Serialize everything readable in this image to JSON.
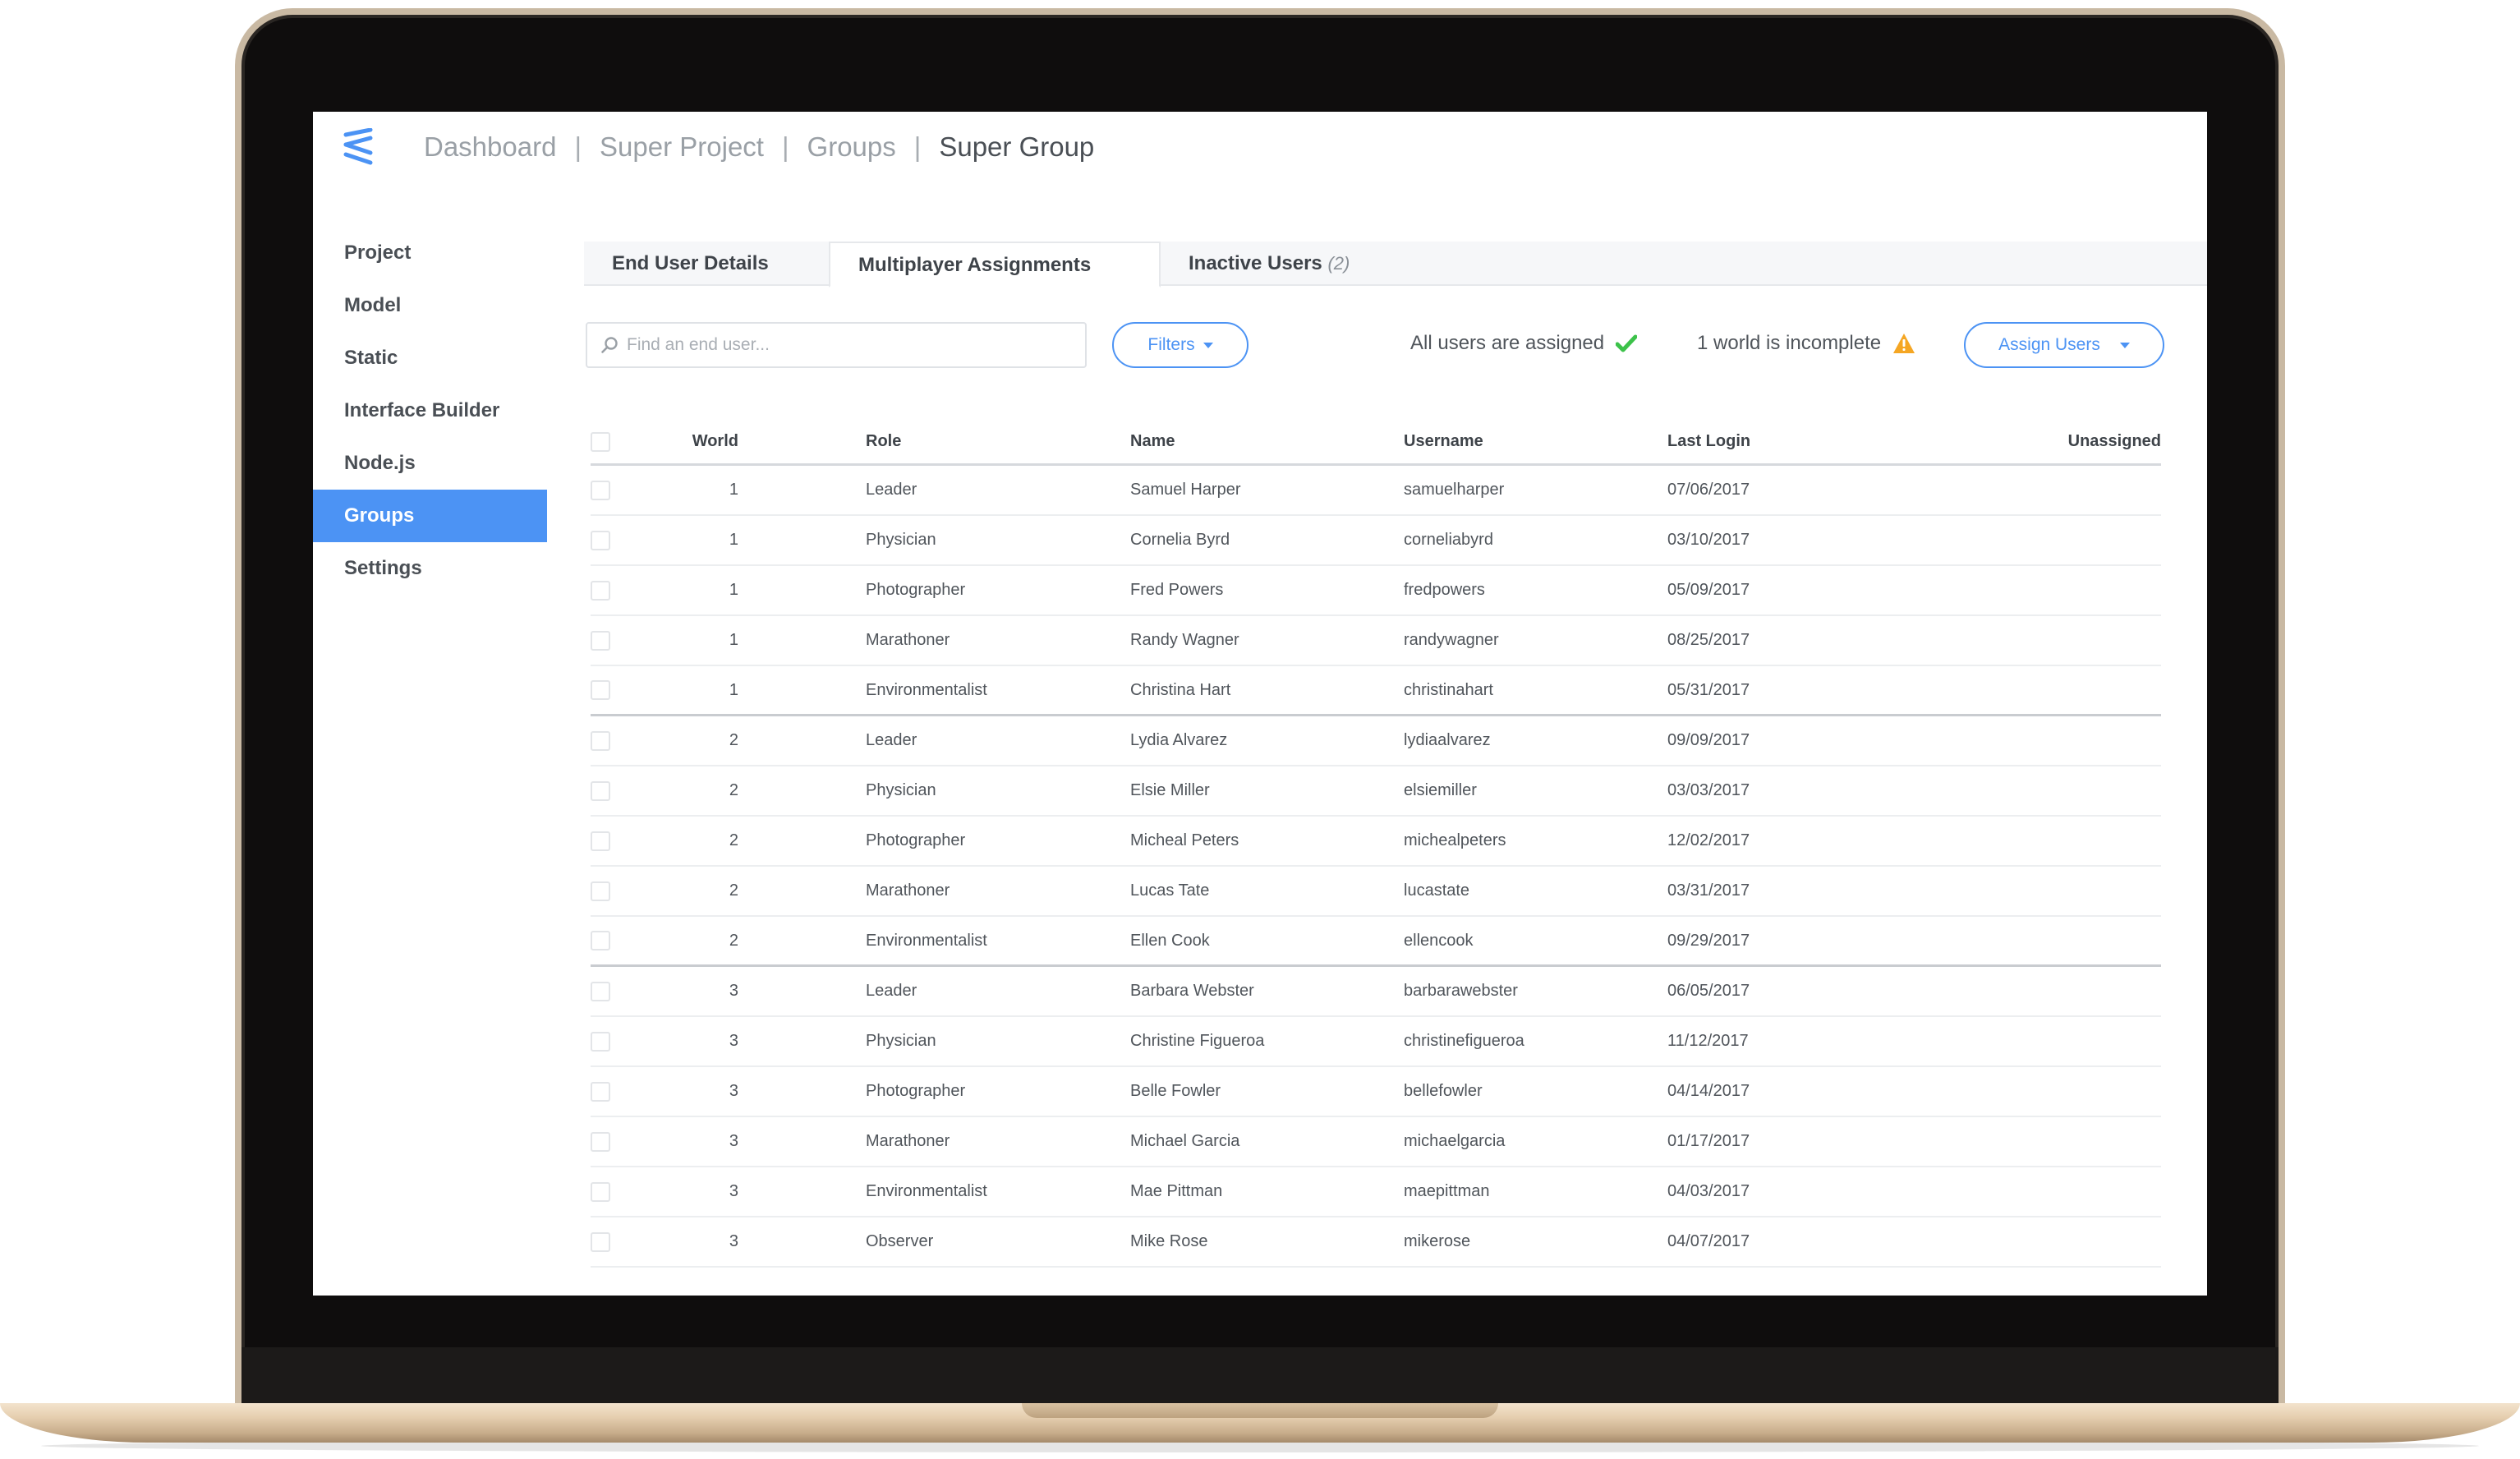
{
  "breadcrumb": [
    "Dashboard",
    "Super Project",
    "Groups",
    "Super Group"
  ],
  "breadcrumb_separator": "|",
  "sidebar": {
    "items": [
      {
        "label": "Project"
      },
      {
        "label": "Model"
      },
      {
        "label": "Static"
      },
      {
        "label": "Interface Builder"
      },
      {
        "label": "Node.js"
      },
      {
        "label": "Groups",
        "active": true
      },
      {
        "label": "Settings"
      }
    ]
  },
  "tabs": [
    {
      "label": "End User Details"
    },
    {
      "label": "Multiplayer Assignments",
      "active": true
    },
    {
      "label": "Inactive Users",
      "count": "(2)"
    }
  ],
  "toolbar": {
    "search_placeholder": "Find an end user...",
    "filters_label": "Filters",
    "status_assigned": "All users are assigned",
    "status_incomplete": "1 world is incomplete",
    "assign_users_label": "Assign Users"
  },
  "colors": {
    "accent": "#4c93f4",
    "success": "#3cc24a",
    "warning": "#f5a623"
  },
  "table": {
    "columns": [
      "World",
      "Role",
      "Name",
      "Username",
      "Last Login",
      "Unassigned"
    ],
    "rows": [
      {
        "world": "1",
        "role": "Leader",
        "name": "Samuel Harper",
        "username": "samuelharper",
        "last_login": "07/06/2017"
      },
      {
        "world": "1",
        "role": "Physician",
        "name": "Cornelia Byrd",
        "username": "corneliabyrd",
        "last_login": "03/10/2017"
      },
      {
        "world": "1",
        "role": "Photographer",
        "name": "Fred Powers",
        "username": "fredpowers",
        "last_login": "05/09/2017"
      },
      {
        "world": "1",
        "role": "Marathoner",
        "name": "Randy Wagner",
        "username": "randywagner",
        "last_login": "08/25/2017"
      },
      {
        "world": "1",
        "role": "Environmentalist",
        "name": "Christina Hart",
        "username": "christinahart",
        "last_login": "05/31/2017"
      },
      {
        "world": "2",
        "role": "Leader",
        "name": "Lydia Alvarez",
        "username": "lydiaalvarez",
        "last_login": "09/09/2017"
      },
      {
        "world": "2",
        "role": "Physician",
        "name": "Elsie Miller",
        "username": "elsiemiller",
        "last_login": "03/03/2017"
      },
      {
        "world": "2",
        "role": "Photographer",
        "name": "Micheal Peters",
        "username": "michealpeters",
        "last_login": "12/02/2017"
      },
      {
        "world": "2",
        "role": "Marathoner",
        "name": "Lucas Tate",
        "username": "lucastate",
        "last_login": "03/31/2017"
      },
      {
        "world": "2",
        "role": "Environmentalist",
        "name": "Ellen Cook",
        "username": "ellencook",
        "last_login": "09/29/2017"
      },
      {
        "world": "3",
        "role": "Leader",
        "name": "Barbara Webster",
        "username": "barbarawebster",
        "last_login": "06/05/2017"
      },
      {
        "world": "3",
        "role": "Physician",
        "name": "Christine Figueroa",
        "username": "christinefigueroa",
        "last_login": "11/12/2017"
      },
      {
        "world": "3",
        "role": "Photographer",
        "name": "Belle Fowler",
        "username": "bellefowler",
        "last_login": "04/14/2017"
      },
      {
        "world": "3",
        "role": "Marathoner",
        "name": "Michael Garcia",
        "username": "michaelgarcia",
        "last_login": "01/17/2017"
      },
      {
        "world": "3",
        "role": "Environmentalist",
        "name": "Mae Pittman",
        "username": "maepittman",
        "last_login": "04/03/2017"
      },
      {
        "world": "3",
        "role": "Observer",
        "name": "Mike Rose",
        "username": "mikerose",
        "last_login": "04/07/2017"
      }
    ]
  }
}
